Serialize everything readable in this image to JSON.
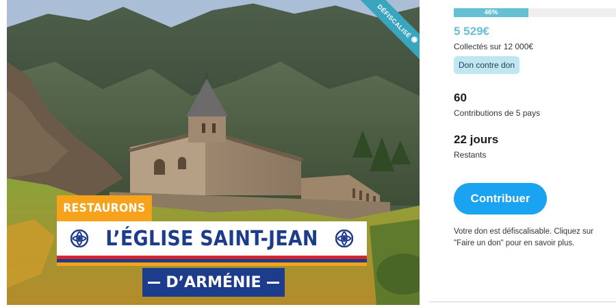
{
  "hero": {
    "ribbon_label": "DÉFISCALISÉ",
    "tag_label": "RESTAURONS",
    "title": "L’ÉGLISE SAINT-JEAN",
    "subtitle": "D’ARMÉNIE"
  },
  "campaign": {
    "progress_percent": 46,
    "progress_label": "46%",
    "amount_raised": "5 529€",
    "collected_label": "Collectés sur 12 000€",
    "reward_badge": "Don contre don",
    "contributions_count": "60",
    "contributions_label": "Contributions de 5 pays",
    "days_left": "22 jours",
    "days_label": "Restants",
    "contribute_button": "Contribuer",
    "tax_note": "Votre don est défiscalisable. Cliquez sur \"Faire un don\" pour en savoir plus."
  },
  "colors": {
    "accent": "#65c0d3",
    "button": "#1aa3f0",
    "badge_bg": "#bfe7f2",
    "armenia_red": "#d8262e",
    "armenia_blue": "#1e3c8c",
    "armenia_orange": "#f6a21a"
  },
  "icons": {
    "ribbon_icon": "piggy-bank-icon",
    "emblem_icon": "armenian-eternity-sign-icon"
  }
}
